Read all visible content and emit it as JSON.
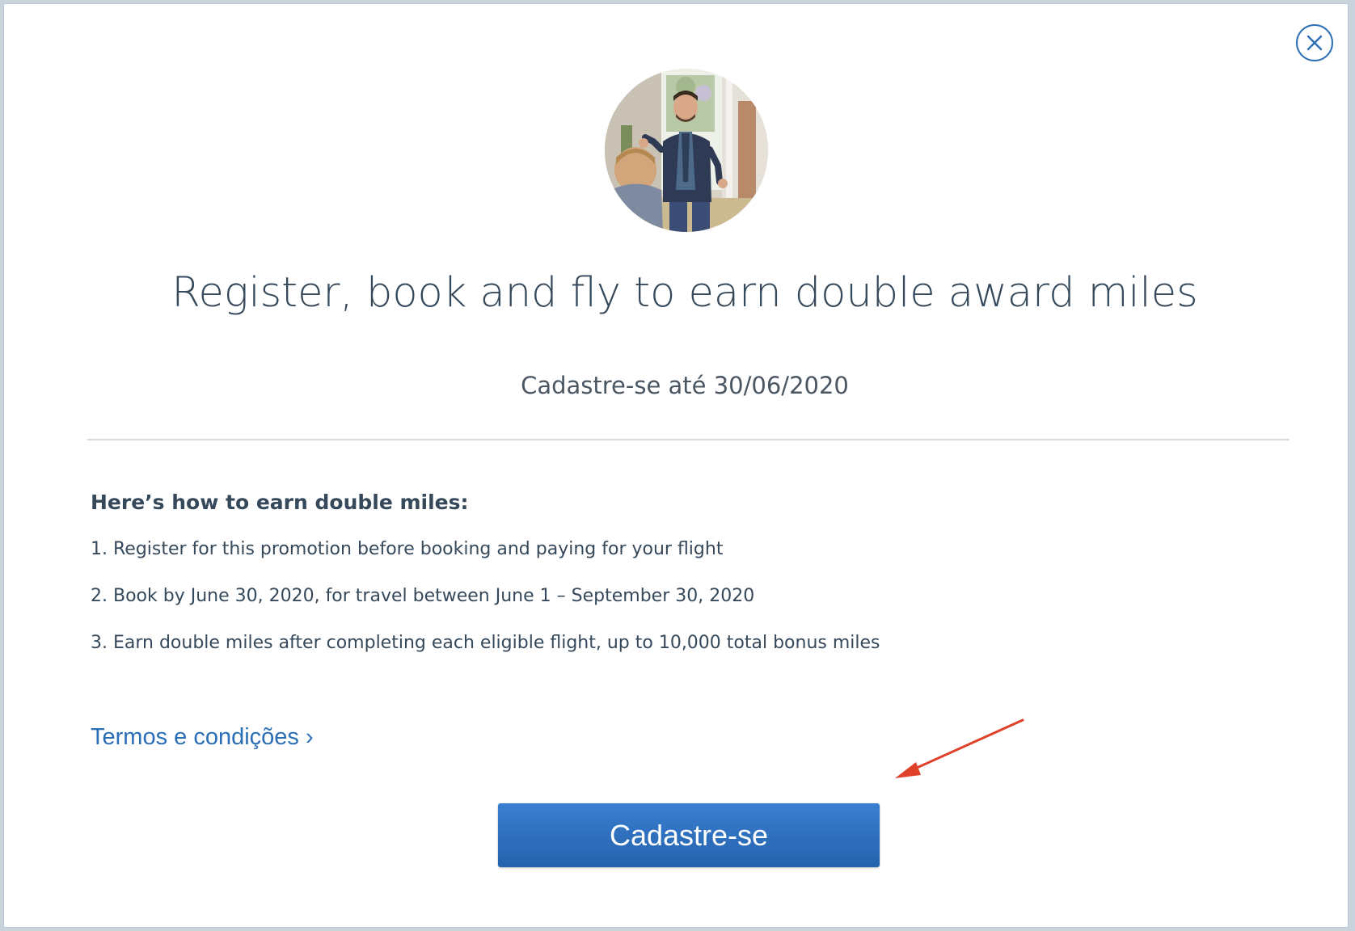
{
  "modal": {
    "title": "Register, book and fly to earn double award miles",
    "subtitle": "Cadastre-se até 30/06/2020",
    "how_heading": "Here’s how to earn double miles:",
    "steps": [
      "1. Register for this promotion before booking and paying for your flight",
      "2. Book by June 30, 2020, for travel between June 1 – September 30, 2020",
      "3. Earn double miles after completing each eligible flight, up to 10,000 total bonus miles"
    ],
    "terms_link": "Termos e condições ›",
    "register_button": "Cadastre-se"
  },
  "icons": {
    "close": "close-icon",
    "arrow": "annotation-arrow"
  },
  "colors": {
    "accent": "#2a6eb5",
    "button": "#2d6fbf",
    "text": "#36495a",
    "annotation": "#e0412b"
  }
}
